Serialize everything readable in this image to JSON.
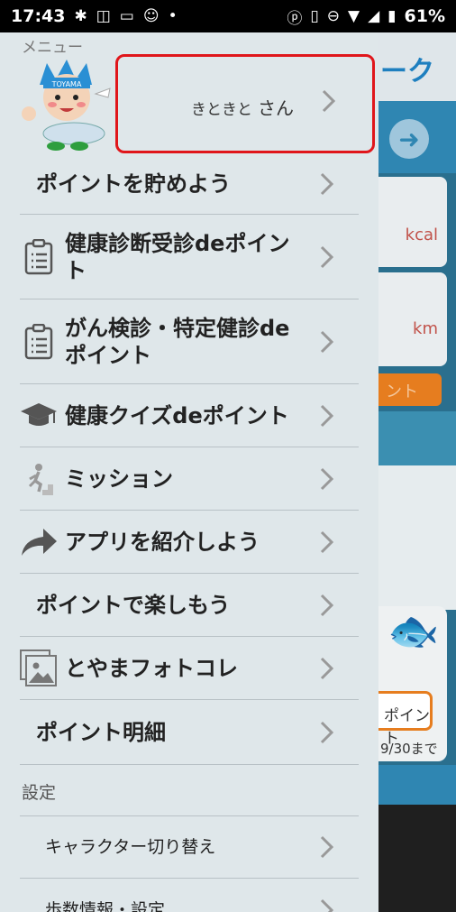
{
  "status_bar": {
    "time": "17:43",
    "battery": "61%"
  },
  "background_app": {
    "title_fragment": "ーク",
    "unit_kcal": "kcal",
    "unit_km": "km",
    "button_fragment": "ント",
    "point_button_fragment": "ポイント",
    "deadline_fragment": "9/30まで"
  },
  "drawer": {
    "header": "メニュー",
    "mascot_text": "TOYAMA",
    "user": {
      "name": "きときと",
      "suffix": "さん"
    },
    "items": [
      {
        "label": "ポイントを貯めよう",
        "icon": "none"
      },
      {
        "label_line1": "健康診断受診deポイン",
        "label_line2": "ト",
        "icon": "clipboard-icon"
      },
      {
        "label_line1": "がん検診・特定健診de",
        "label_line2": "ポイント",
        "icon": "clipboard-icon"
      },
      {
        "label": "健康クイズdeポイント",
        "icon": "graduation-cap-icon"
      },
      {
        "label": "ミッション",
        "icon": "stairs-runner-icon"
      },
      {
        "label": "アプリを紹介しよう",
        "icon": "share-arrow-icon"
      },
      {
        "label": "ポイントで楽しもう",
        "icon": "none"
      },
      {
        "label": "とやまフォトコレ",
        "icon": "photo-gallery-icon"
      },
      {
        "label": "ポイント明細",
        "icon": "none"
      }
    ],
    "settings_section": "設定",
    "settings_items": [
      {
        "label": "キャラクター切り替え"
      },
      {
        "label": "歩数情報・設定"
      }
    ]
  },
  "colors": {
    "drawer_bg": "#dfe7ea",
    "highlight_border": "#e0161b",
    "accent_blue": "#2f86b2",
    "accent_orange": "#e67d1f"
  }
}
